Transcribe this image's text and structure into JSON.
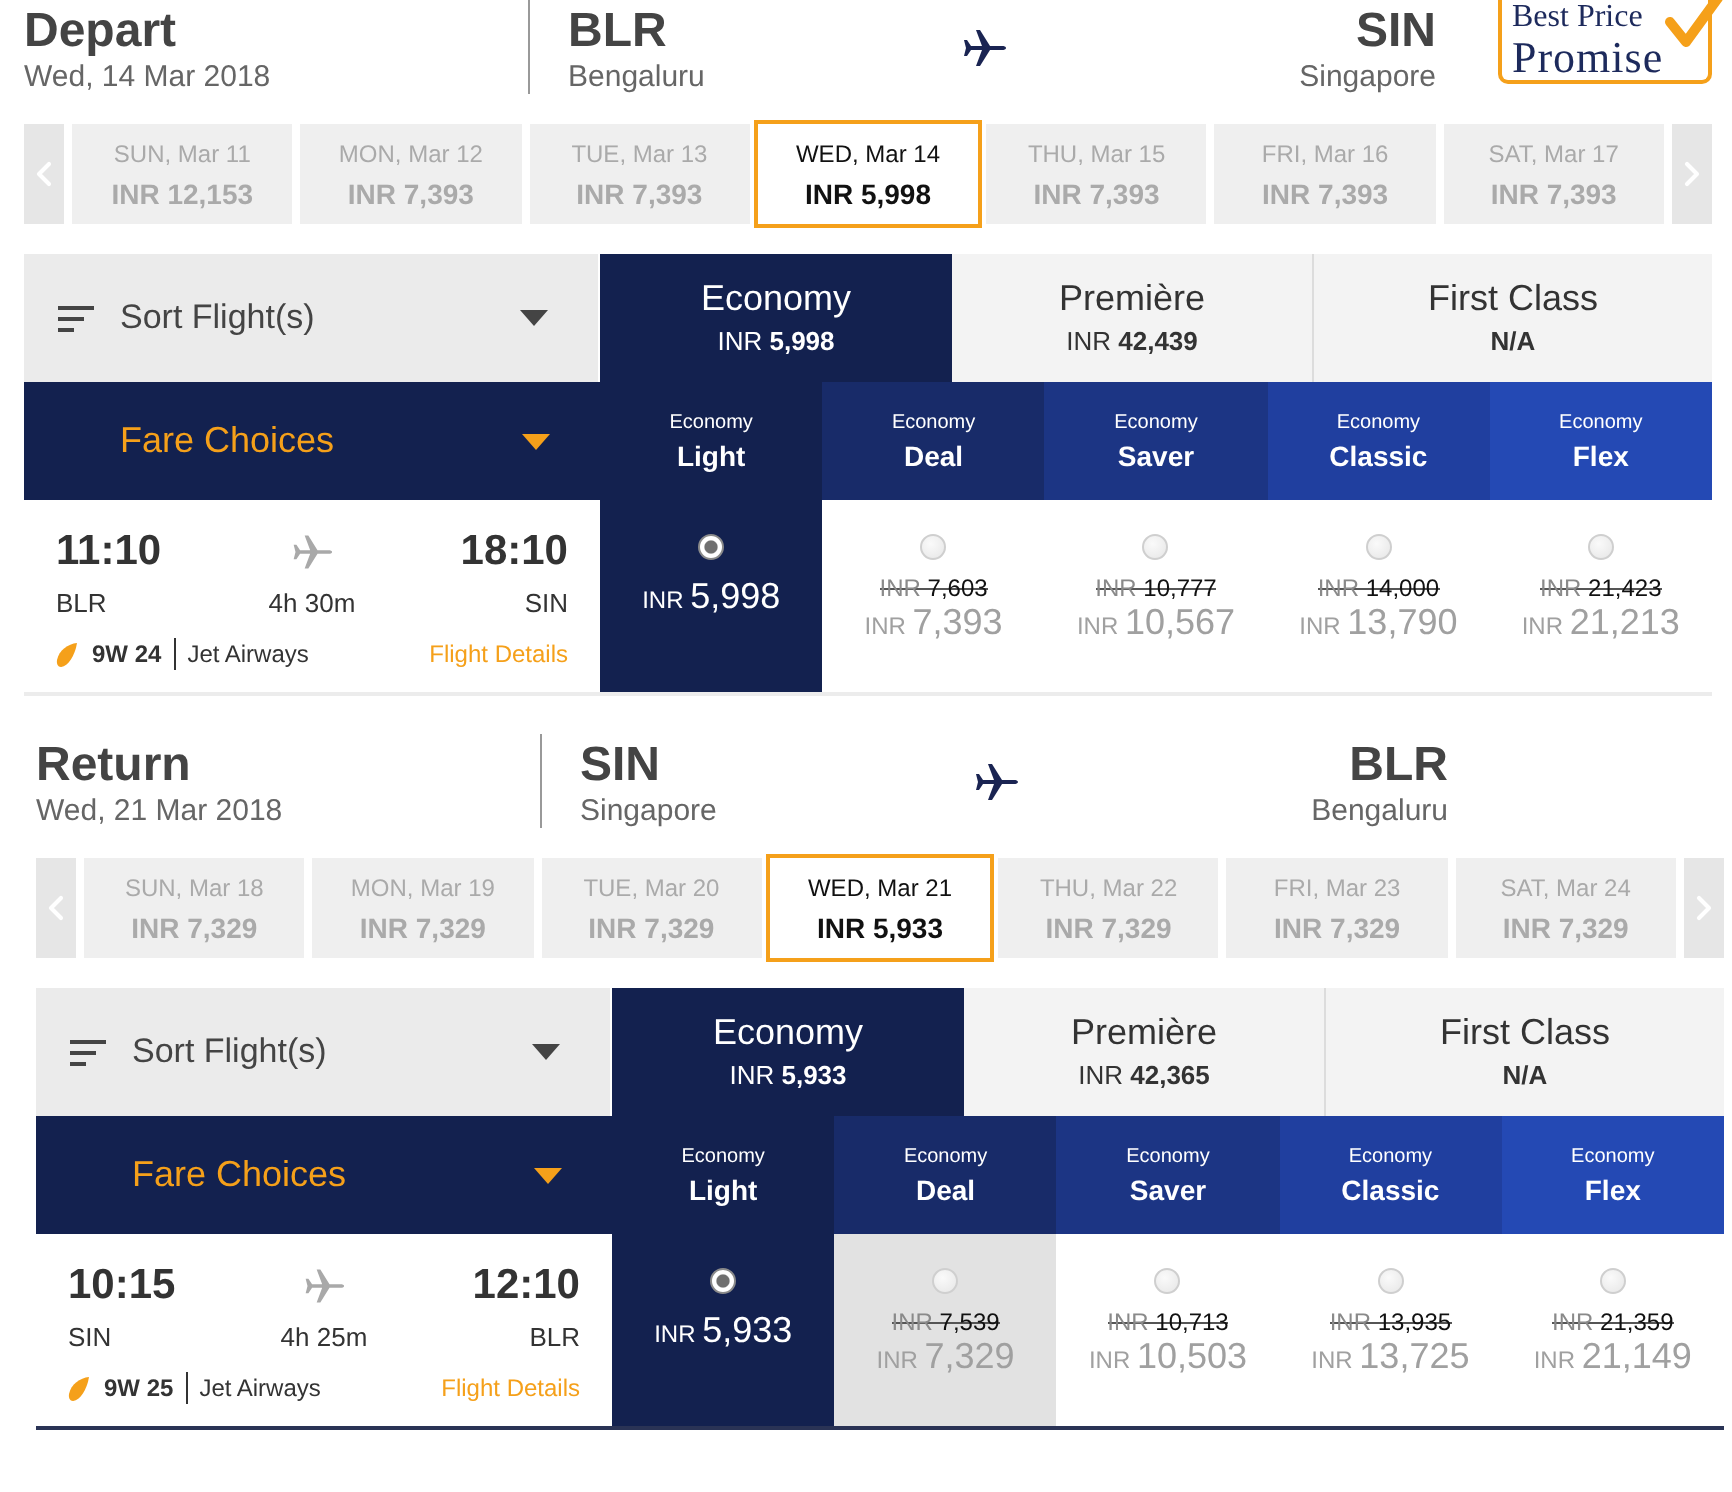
{
  "badge": {
    "line_1": "Best Price",
    "line_2": "Promise"
  },
  "legs": [
    {
      "title": "Depart",
      "date": "Wed, 14 Mar 2018",
      "origin": {
        "code": "BLR",
        "city": "Bengaluru"
      },
      "destination": {
        "code": "SIN",
        "city": "Singapore"
      },
      "dates": [
        {
          "day": "SUN, Mar 11",
          "price": "INR 12,153",
          "selected": false
        },
        {
          "day": "MON, Mar 12",
          "price": "INR 7,393",
          "selected": false
        },
        {
          "day": "TUE, Mar 13",
          "price": "INR 7,393",
          "selected": false
        },
        {
          "day": "WED, Mar 14",
          "price": "INR 5,998",
          "selected": true
        },
        {
          "day": "THU, Mar 15",
          "price": "INR 7,393",
          "selected": false
        },
        {
          "day": "FRI, Mar 16",
          "price": "INR 7,393",
          "selected": false
        },
        {
          "day": "SAT, Mar 17",
          "price": "INR 7,393",
          "selected": false
        }
      ],
      "sort_label": "Sort Flight(s)",
      "cabins": [
        {
          "name": "Economy",
          "currency": "INR",
          "amount": "5,998",
          "selected": true
        },
        {
          "name": "Première",
          "currency": "INR",
          "amount": "42,439",
          "selected": false
        },
        {
          "name": "First Class",
          "amount": "N/A",
          "selected": false
        }
      ],
      "fare_choices_label": "Fare Choices",
      "fare_types": [
        {
          "family": "Economy",
          "name": "Light"
        },
        {
          "family": "Economy",
          "name": "Deal"
        },
        {
          "family": "Economy",
          "name": "Saver"
        },
        {
          "family": "Economy",
          "name": "Classic"
        },
        {
          "family": "Economy",
          "name": "Flex"
        }
      ],
      "flight": {
        "departure_time": "11:10",
        "origin": "BLR",
        "duration": "4h 30m",
        "arrival_time": "18:10",
        "destination": "SIN",
        "flight_number": "9W 24",
        "airline": "Jet Airways",
        "details_link": "Flight Details"
      },
      "fares": [
        {
          "currency": "INR",
          "amount": "5,998",
          "selected": true,
          "highlighted": false
        },
        {
          "was": {
            "currency": "INR",
            "amount": "7,603"
          },
          "currency": "INR",
          "amount": "7,393",
          "selected": false,
          "highlighted": false
        },
        {
          "was": {
            "currency": "INR",
            "amount": "10,777"
          },
          "currency": "INR",
          "amount": "10,567",
          "selected": false,
          "highlighted": false
        },
        {
          "was": {
            "currency": "INR",
            "amount": "14,000"
          },
          "currency": "INR",
          "amount": "13,790",
          "selected": false,
          "highlighted": false
        },
        {
          "was": {
            "currency": "INR",
            "amount": "21,423"
          },
          "currency": "INR",
          "amount": "21,213",
          "selected": false,
          "highlighted": false
        }
      ]
    },
    {
      "title": "Return",
      "date": "Wed, 21 Mar 2018",
      "origin": {
        "code": "SIN",
        "city": "Singapore"
      },
      "destination": {
        "code": "BLR",
        "city": "Bengaluru"
      },
      "dates": [
        {
          "day": "SUN, Mar 18",
          "price": "INR 7,329",
          "selected": false
        },
        {
          "day": "MON, Mar 19",
          "price": "INR 7,329",
          "selected": false
        },
        {
          "day": "TUE, Mar 20",
          "price": "INR 7,329",
          "selected": false
        },
        {
          "day": "WED, Mar 21",
          "price": "INR 5,933",
          "selected": true
        },
        {
          "day": "THU, Mar 22",
          "price": "INR 7,329",
          "selected": false
        },
        {
          "day": "FRI, Mar 23",
          "price": "INR 7,329",
          "selected": false
        },
        {
          "day": "SAT, Mar 24",
          "price": "INR 7,329",
          "selected": false
        }
      ],
      "sort_label": "Sort Flight(s)",
      "cabins": [
        {
          "name": "Economy",
          "currency": "INR",
          "amount": "5,933",
          "selected": true
        },
        {
          "name": "Première",
          "currency": "INR",
          "amount": "42,365",
          "selected": false
        },
        {
          "name": "First Class",
          "amount": "N/A",
          "selected": false
        }
      ],
      "fare_choices_label": "Fare Choices",
      "fare_types": [
        {
          "family": "Economy",
          "name": "Light"
        },
        {
          "family": "Economy",
          "name": "Deal"
        },
        {
          "family": "Economy",
          "name": "Saver"
        },
        {
          "family": "Economy",
          "name": "Classic"
        },
        {
          "family": "Economy",
          "name": "Flex"
        }
      ],
      "flight": {
        "departure_time": "10:15",
        "origin": "SIN",
        "duration": "4h 25m",
        "arrival_time": "12:10",
        "destination": "BLR",
        "flight_number": "9W 25",
        "airline": "Jet Airways",
        "details_link": "Flight Details"
      },
      "fares": [
        {
          "currency": "INR",
          "amount": "5,933",
          "selected": true,
          "highlighted": false
        },
        {
          "was": {
            "currency": "INR",
            "amount": "7,539"
          },
          "currency": "INR",
          "amount": "7,329",
          "selected": false,
          "highlighted": true
        },
        {
          "was": {
            "currency": "INR",
            "amount": "10,713"
          },
          "currency": "INR",
          "amount": "10,503",
          "selected": false,
          "highlighted": false
        },
        {
          "was": {
            "currency": "INR",
            "amount": "13,935"
          },
          "currency": "INR",
          "amount": "13,725",
          "selected": false,
          "highlighted": false
        },
        {
          "was": {
            "currency": "INR",
            "amount": "21,359"
          },
          "currency": "INR",
          "amount": "21,149",
          "selected": false,
          "highlighted": false
        }
      ]
    }
  ]
}
